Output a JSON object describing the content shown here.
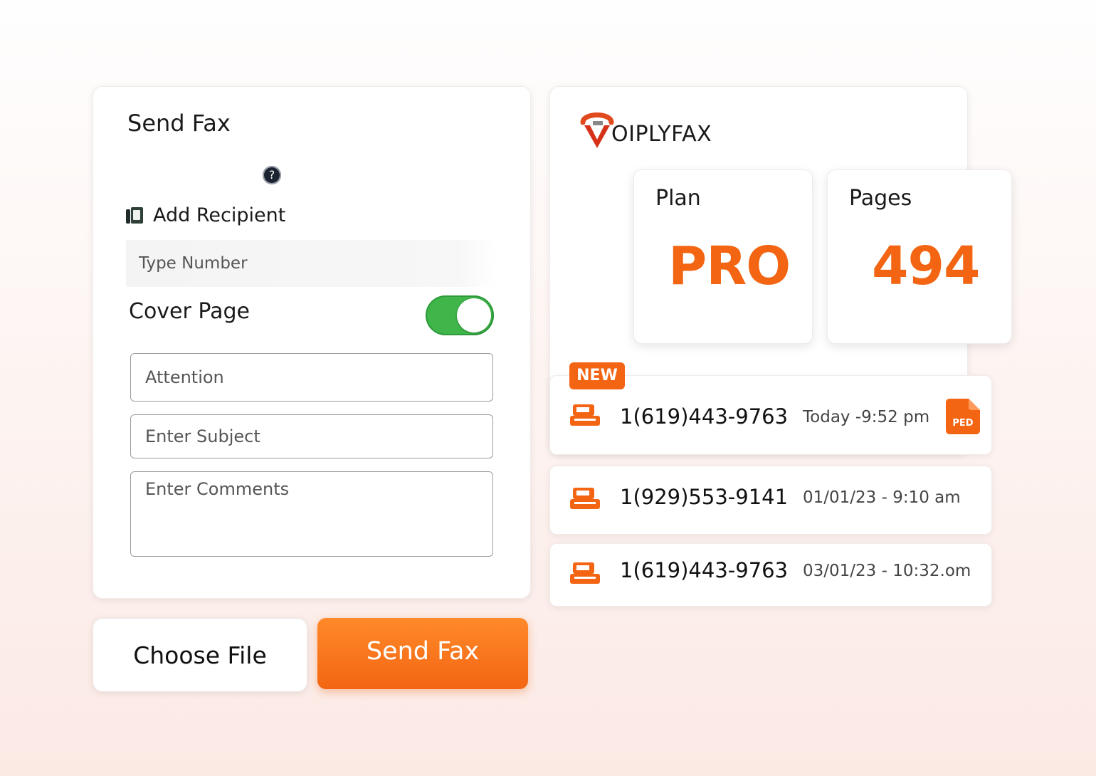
{
  "send_fax": {
    "title": "Send Fax",
    "add_recipient_label": "Add Recipient",
    "number_placeholder": "Type Number",
    "cover_page_label": "Cover Page",
    "cover_page_enabled": true,
    "attention_placeholder": "Attention",
    "subject_placeholder": "Enter Subject",
    "comments_placeholder": "Enter Comments"
  },
  "actions": {
    "choose_file_label": "Choose File",
    "send_label": "Send Fax"
  },
  "brand": {
    "logo_text_accent": "V",
    "logo_text": "OIPLYFAX",
    "accent_color": "#f36512"
  },
  "stats": {
    "plan_label": "Plan",
    "plan_value": "PRO",
    "pages_label": "Pages",
    "pages_value": "494"
  },
  "fax_list": {
    "new_badge": "NEW",
    "items": [
      {
        "number": "1(619)443-9763",
        "time": "Today -9:52 pm",
        "attachment": "PED"
      },
      {
        "number": "1(929)553-9141",
        "time": "01/01/23 - 9:10 am"
      },
      {
        "number": "1(619)443-9763",
        "time": "03/01/23 - 10:32.om"
      }
    ]
  }
}
